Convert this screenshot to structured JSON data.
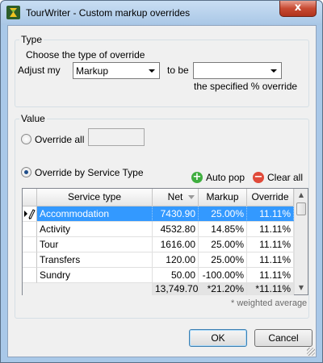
{
  "window": {
    "title": "TourWriter - Custom markup overrides",
    "close_glyph": "x"
  },
  "type_group": {
    "title": "Type",
    "instruction": "Choose the type of override",
    "adjust_label": "Adjust my",
    "adjust_value": "Markup",
    "to_be_label": "to be",
    "override_value": "",
    "override_note": "the specified % override"
  },
  "value_group": {
    "title": "Value",
    "override_all_label": "Override all",
    "override_all_value": "",
    "override_by_service_label": "Override by Service Type",
    "selected_mode": "override_by_service_type",
    "auto_pop_label": "Auto pop",
    "clear_all_label": "Clear all",
    "footnote": "* weighted average"
  },
  "grid": {
    "columns": [
      "Service type",
      "Net",
      "Markup",
      "Override"
    ],
    "rows": [
      {
        "service_type": "Accommodation",
        "net": "7430.90",
        "markup": "25.00%",
        "override": "11.11%",
        "selected": true
      },
      {
        "service_type": "Activity",
        "net": "4532.80",
        "markup": "14.85%",
        "override": "11.11%"
      },
      {
        "service_type": "Tour",
        "net": "1616.00",
        "markup": "25.00%",
        "override": "11.11%"
      },
      {
        "service_type": "Transfers",
        "net": "120.00",
        "markup": "25.00%",
        "override": "11.11%"
      },
      {
        "service_type": "Sundry",
        "net": "50.00",
        "markup": "-100.00%",
        "override": "11.11%"
      }
    ],
    "totals": {
      "net": "13,749.70",
      "markup": "*21.20%",
      "override": "*11.11%"
    }
  },
  "buttons": {
    "ok": "OK",
    "cancel": "Cancel"
  },
  "icons": {
    "app": "tourwriter-logo-icon",
    "auto_pop": "plus-circle-icon",
    "clear_all": "minus-circle-icon",
    "row_edit": "pencil-icon",
    "row_current": "row-pointer-icon",
    "sort": "sort-descending-icon"
  },
  "colors": {
    "selection": "#3399ff",
    "auto_pop_icon": "#3fae3f",
    "clear_all_icon": "#e04a3a"
  }
}
